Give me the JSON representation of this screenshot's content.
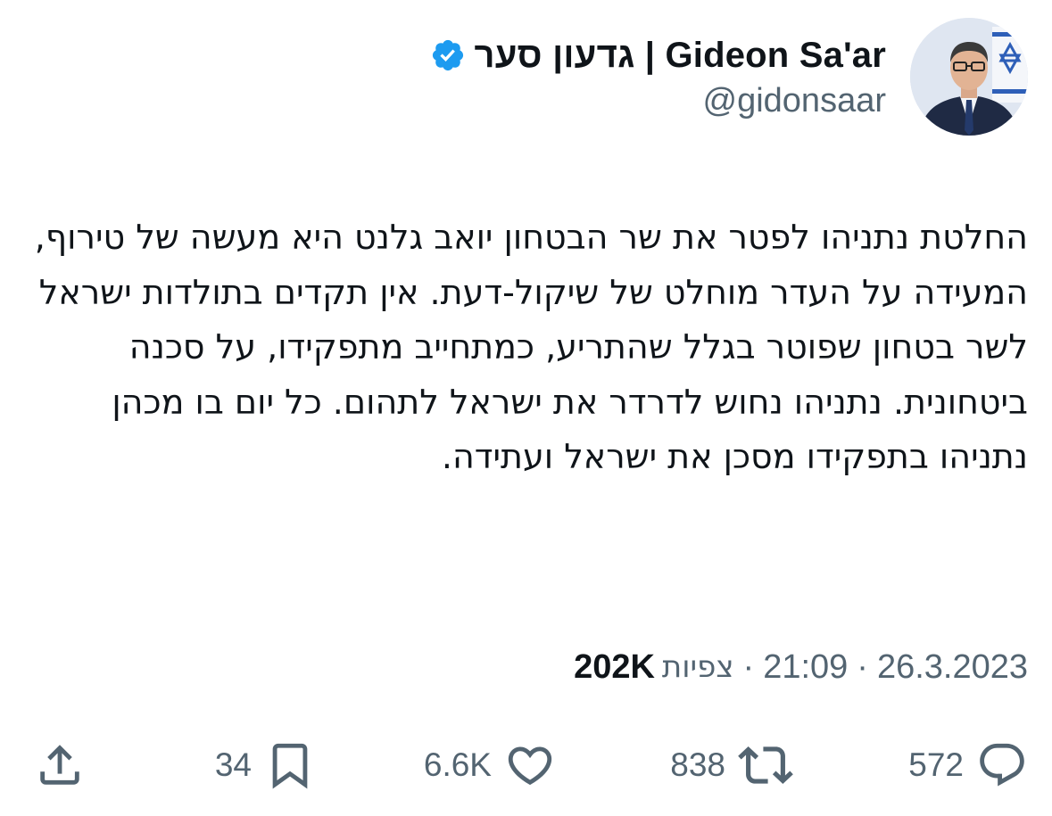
{
  "author": {
    "display_name": "גדעון סער | Gideon Sa'ar",
    "handle": "@gidonsaar",
    "verified": true,
    "avatar_icon": "profile-photo"
  },
  "tweet": {
    "text": "החלטת נתניהו לפטר את שר הבטחון יואב גלנט היא מעשה של טירוף, המעידה על העדר מוחלט של שיקול-דעת. אין תקדים בתולדות ישראל לשר בטחון שפוטר בגלל שהתריע, כמתחייב מתפקידו, על סכנה ביטחונית. נתניהו נחוש לדרדר את ישראל לתהום. כל יום בו מכהן נתניהו בתפקידו מסכן את ישראל ועתידה."
  },
  "meta": {
    "date": "26.3.2023",
    "separator": "·",
    "time": "21:09",
    "views_label": "צפיות",
    "views_count": "202K"
  },
  "actions": {
    "reply_count": "572",
    "retweet_count": "838",
    "like_count": "6.6K",
    "bookmark_count": "34",
    "icons": [
      "reply-icon",
      "retweet-icon",
      "like-icon",
      "bookmark-icon",
      "share-icon"
    ]
  },
  "colors": {
    "text": "#0f1419",
    "secondary": "#536471",
    "verified": "#1d9bf0",
    "background": "#ffffff"
  }
}
